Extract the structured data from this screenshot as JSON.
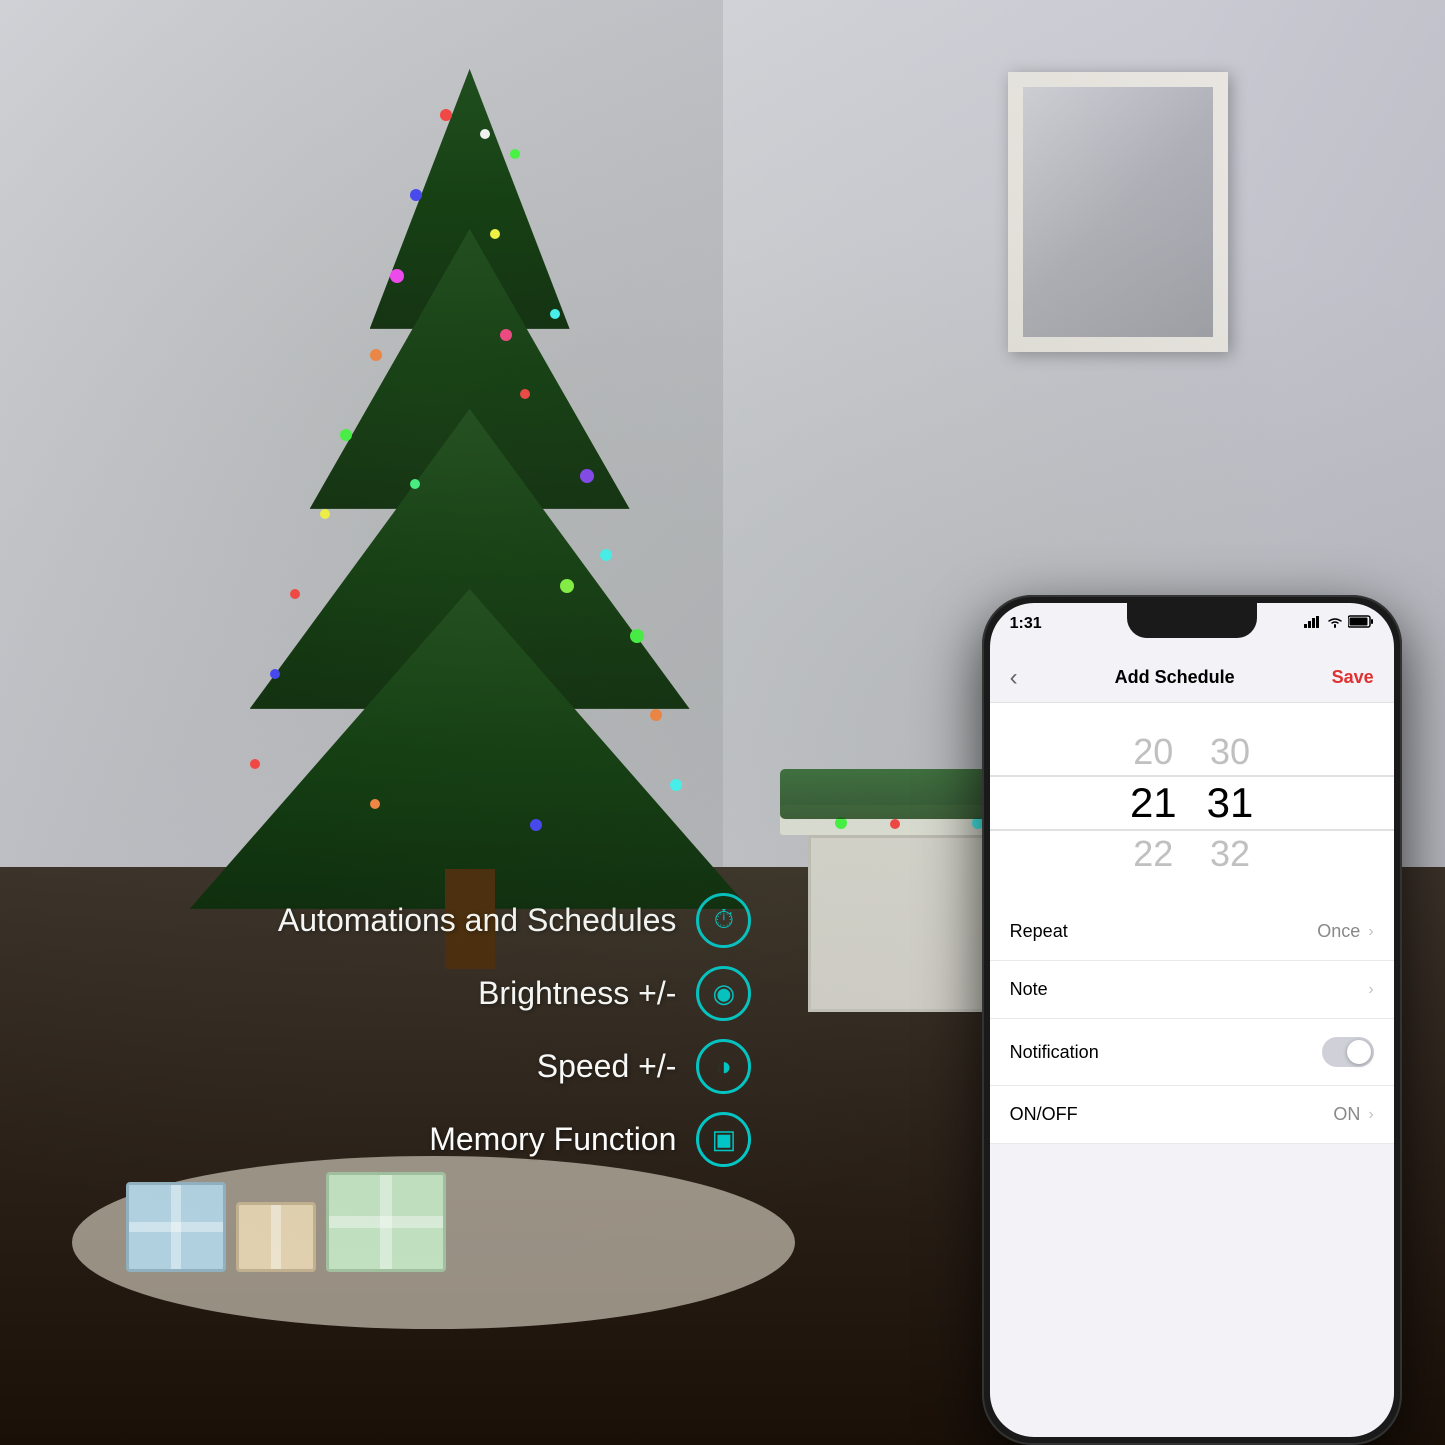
{
  "scene": {
    "background_desc": "Christmas tree in a living room with colorful lights"
  },
  "features": [
    {
      "id": "automations",
      "label": "Automations and Schedules",
      "icon": "⏱"
    },
    {
      "id": "brightness",
      "label": "Brightness +/-",
      "icon": "◉"
    },
    {
      "id": "speed",
      "label": "Speed +/-",
      "icon": "◑"
    },
    {
      "id": "memory",
      "label": "Memory Function",
      "icon": "▣"
    }
  ],
  "phone": {
    "status_bar": {
      "time": "1:31",
      "icons": "◉ ◉ ◉ ▲▲▲ ▮▮▮ ⬛"
    },
    "nav": {
      "back_label": "‹",
      "title": "Add Schedule",
      "save_label": "Save"
    },
    "time_picker": {
      "hours": [
        "20",
        "21",
        "22"
      ],
      "minutes": [
        "30",
        "31",
        "32"
      ],
      "selected_hour": "21",
      "selected_minute": "31"
    },
    "settings_rows": [
      {
        "id": "repeat",
        "label": "Repeat",
        "value": "Once",
        "has_chevron": true,
        "type": "value"
      },
      {
        "id": "note",
        "label": "Note",
        "value": "",
        "has_chevron": true,
        "type": "value"
      },
      {
        "id": "notification",
        "label": "Notification",
        "value": "",
        "has_chevron": false,
        "type": "toggle",
        "toggle_on": false
      },
      {
        "id": "onoff",
        "label": "ON/OFF",
        "value": "ON",
        "has_chevron": true,
        "type": "value"
      }
    ]
  },
  "colors": {
    "accent_teal": "#00c8c8",
    "save_red": "#e03030",
    "phone_bg": "#f2f2f7",
    "tree_green": "#1a4a1a"
  }
}
